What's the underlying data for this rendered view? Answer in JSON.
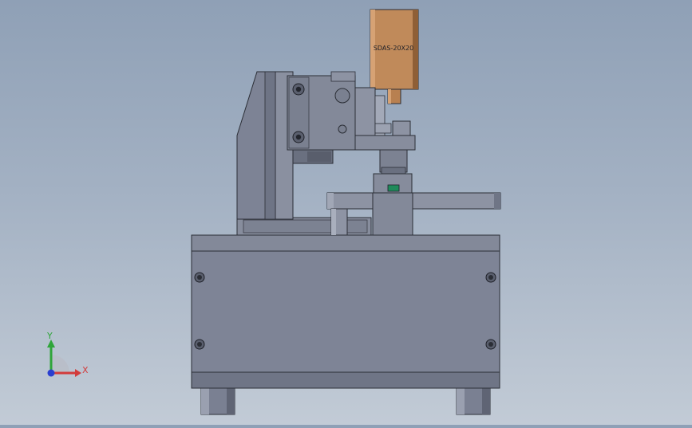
{
  "viewport": {
    "background_top": "#8fa0b6",
    "background_bottom": "#c2cbd6"
  },
  "model": {
    "cylinder_label": "SDAS-20X20",
    "body_color": "#7e8496",
    "body_dark": "#5f6474",
    "body_light": "#9aa0b0",
    "cylinder_color": "#c08a5a",
    "cylinder_dark": "#8f5f36",
    "edge_color": "#2b2e36",
    "sensor_color": "#1f8a5a"
  },
  "triad": {
    "x_label": "X",
    "y_label": "Y",
    "x_color": "#d23b3b",
    "y_color": "#2fa53a",
    "z_color": "#2a3fd0"
  }
}
